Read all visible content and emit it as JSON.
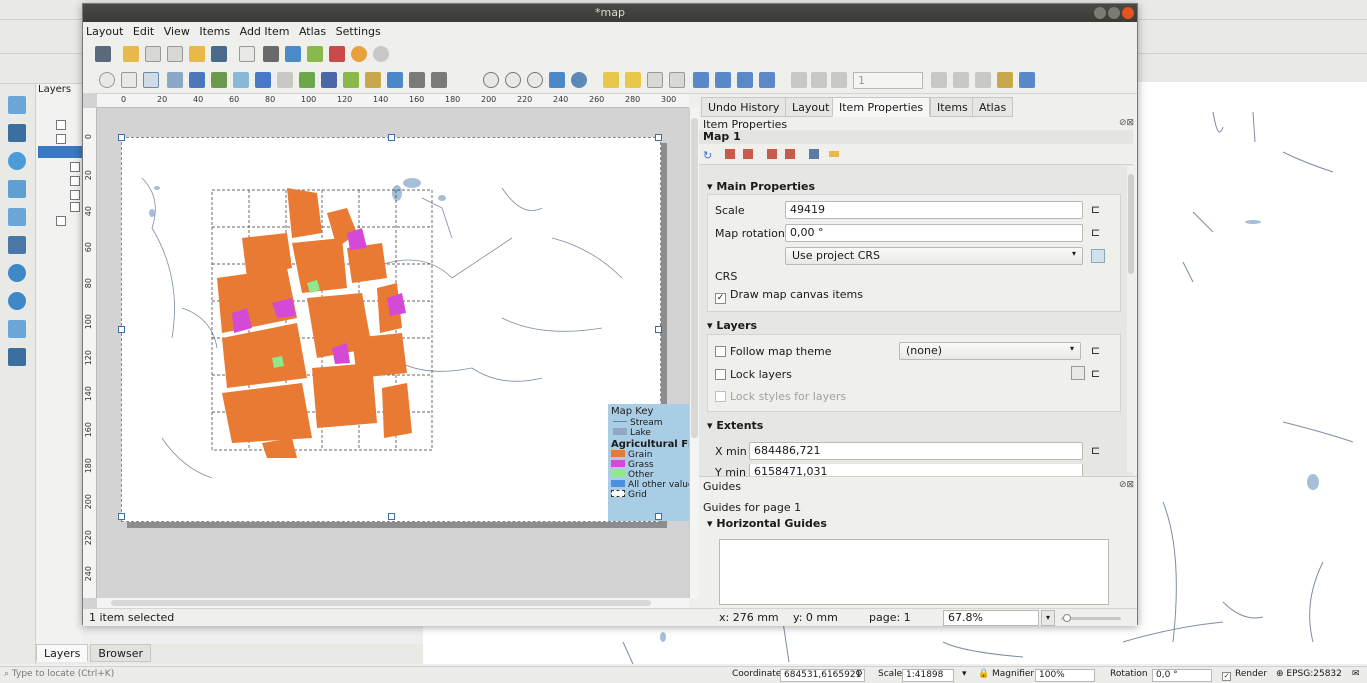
{
  "main": {
    "layers_panel_title": "Layers",
    "tabs": [
      "Layers",
      "Browser"
    ],
    "locator_placeholder": "Type to locate (Ctrl+K)",
    "status": {
      "coordinate_label": "Coordinate",
      "coordinate_value": "684531,6165921",
      "scale_label": "Scale",
      "scale_value": "1:41898",
      "magnifier_label": "Magnifier",
      "magnifier_value": "100%",
      "rotation_label": "Rotation",
      "rotation_value": "0,0 °",
      "render_label": "Render",
      "crs": "EPSG:25832"
    }
  },
  "layout": {
    "window_title": "*map",
    "menu": [
      "Layout",
      "Edit",
      "View",
      "Items",
      "Add Item",
      "Atlas",
      "Settings"
    ],
    "atlas_page": "1",
    "status": {
      "selected": "1 item selected",
      "x": "x: 276 mm",
      "y": "y: 0 mm",
      "page": "page: 1",
      "zoom": "67.8%"
    },
    "ruler_top": [
      "0",
      "20",
      "40",
      "60",
      "80",
      "100",
      "120",
      "140",
      "160",
      "180",
      "200",
      "220",
      "240",
      "260",
      "280",
      "300"
    ],
    "ruler_left": [
      "0",
      "20",
      "40",
      "60",
      "80",
      "100",
      "120",
      "140",
      "160",
      "180",
      "200",
      "220",
      "240"
    ],
    "legend": {
      "title": "Map Key",
      "items": [
        {
          "label": "Stream",
          "color": "#8aa0b8",
          "type": "line"
        },
        {
          "label": "Lake",
          "color": "#a5bfd9",
          "type": "fill"
        }
      ],
      "group_title": "Agricultural Fields",
      "group_items": [
        {
          "label": "Grain",
          "color": "#e87a34"
        },
        {
          "label": "Grass",
          "color": "#d44ad6"
        },
        {
          "label": "Other",
          "color": "#8fe88a"
        },
        {
          "label": "All other values",
          "color": "#4f8fe0"
        },
        {
          "label": "Grid",
          "color": "#ffffff"
        }
      ]
    }
  },
  "panel": {
    "tabs": [
      "Undo History",
      "Layout",
      "Item Properties",
      "Items",
      "Atlas"
    ],
    "header": "Item Properties",
    "item_name": "Map 1",
    "main_props": {
      "title": "Main Properties",
      "scale_label": "Scale",
      "scale_value": "49419",
      "rotation_label": "Map rotation",
      "rotation_value": "0,00 °",
      "crs_combo": "Use project CRS",
      "crs_label": "CRS",
      "draw_items": "Draw map canvas items"
    },
    "layers": {
      "title": "Layers",
      "follow_theme": "Follow map theme",
      "theme_value": "(none)",
      "lock_layers": "Lock layers",
      "lock_styles": "Lock styles for layers"
    },
    "extents": {
      "title": "Extents",
      "xmin_label": "X min",
      "xmin_value": "684486,721",
      "ymin_label": "Y min",
      "ymin_value": "6158471,031"
    },
    "guides": {
      "title": "Guides",
      "subtitle": "Guides for page 1",
      "horizontal": "Horizontal Guides"
    }
  }
}
